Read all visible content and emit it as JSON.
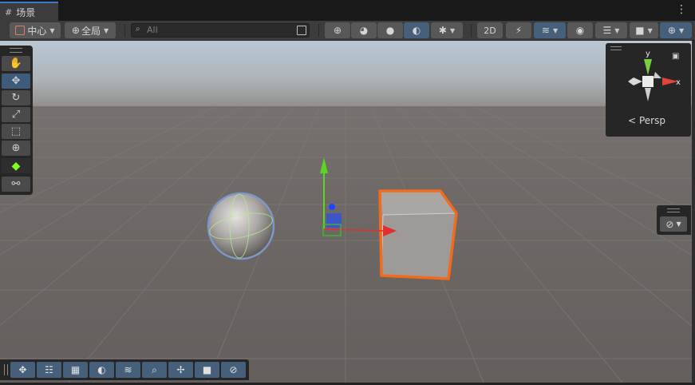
{
  "tab": {
    "title": "场景"
  },
  "toolbar": {
    "pivot_label": "中心",
    "space_label": "全局",
    "search_placeholder": "All"
  },
  "gizmo": {
    "y_label": "y",
    "x_label": "x",
    "projection_label": "Persp"
  },
  "colors": {
    "accent": "#46607c",
    "tab_highlight": "#3a78c8",
    "selection_outline": "#f26a1b",
    "axis_x": "#e0302e",
    "axis_y": "#5bd623",
    "axis_z": "#2f4fe6"
  }
}
